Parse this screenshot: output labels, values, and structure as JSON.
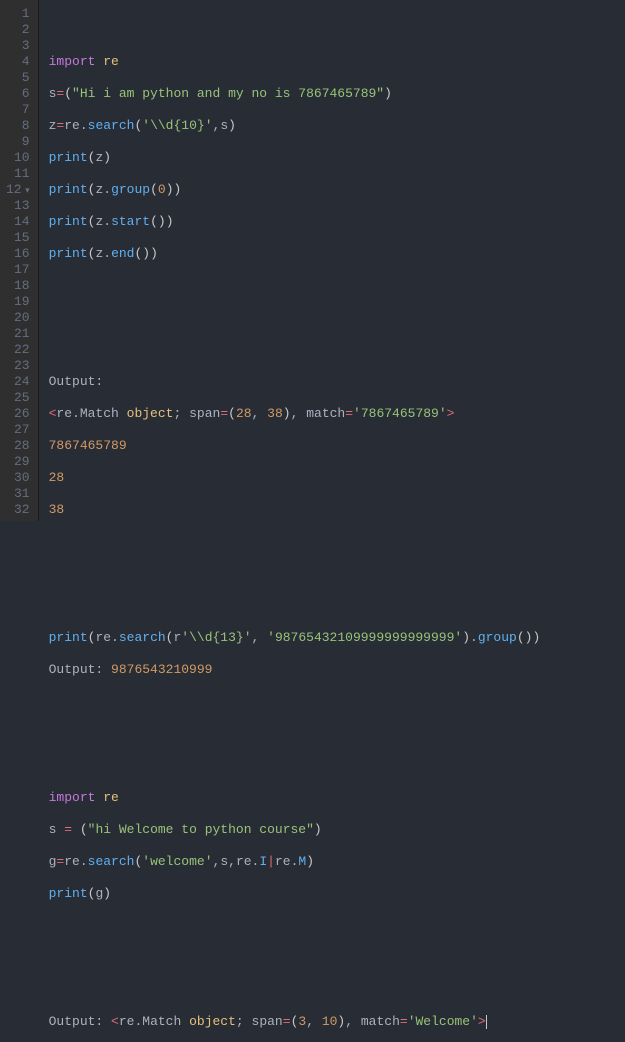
{
  "gutter": [
    "1",
    "2",
    "3",
    "4",
    "5",
    "6",
    "7",
    "8",
    "9",
    "10",
    "11",
    "12",
    "13",
    "14",
    "15",
    "16",
    "17",
    "18",
    "19",
    "20",
    "21",
    "22",
    "23",
    "24",
    "25",
    "26",
    "27",
    "28",
    "29",
    "30",
    "31",
    "32"
  ],
  "code": {
    "kw_import": "import",
    "mod_re": "re",
    "var_s": "s",
    "var_z": "z",
    "var_g": "g",
    "op_eq": "=",
    "op_pipe": "|",
    "fn_print": "print",
    "fn_search": "search",
    "fn_group": "group",
    "fn_start": "start",
    "fn_end": "end",
    "attr_I": "I",
    "attr_M": "M",
    "str1": "\"Hi i am python and my no is 7867465789\"",
    "str2": "'\\\\d{10}'",
    "str3": "'\\\\d{13}'",
    "str4": "'98765432109999999999999'",
    "str5": "\"hi Welcome to python course\"",
    "str6": "'welcome'",
    "str_match1": "'7867465789'",
    "str_match2": "'Welcome'",
    "num0": "0",
    "num28": "28",
    "num38": "38",
    "num3": "3",
    "num10": "10",
    "lp": "(",
    "rp": ")",
    "lt": "<",
    "gt": ">",
    "comma": ",",
    "dot": ".",
    "semi": ";",
    "colon": ":",
    "sp": " ",
    "r_prefix": "r",
    "txt_output": "Output",
    "txt_rematch": "re.Match",
    "txt_object": "object",
    "txt_span": "span",
    "txt_match": "match",
    "out_7867465789": "7867465789",
    "out_28": "28",
    "out_38": "38",
    "out_9876543210999": "9876543210999",
    "fold_marker": "▾"
  }
}
